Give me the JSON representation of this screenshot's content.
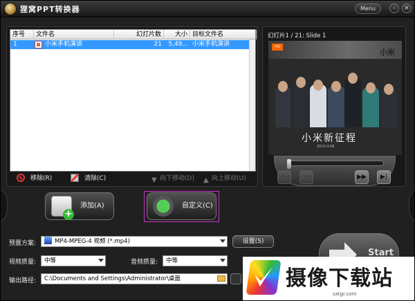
{
  "window": {
    "title": "狸窝PPT转换器",
    "menu_label": "Menu",
    "minimize_glyph": "–",
    "close_glyph": "×"
  },
  "file_list": {
    "columns": {
      "index": "序号",
      "file_name": "文件名",
      "slide_count": "幻灯片数",
      "size": "大小",
      "target_name": "目标文件名"
    },
    "rows": [
      {
        "index": "1",
        "file_name": "小米手机演讲",
        "slide_count": "21",
        "size": "5,49...",
        "target_name": "小米手机演讲",
        "selected": true
      }
    ],
    "toolbar": {
      "remove": "移除(R)",
      "clear": "清除(C)",
      "move_down": "向下移动(D)",
      "move_up": "向上移动(U)"
    }
  },
  "preview": {
    "slide_info": "幻灯片1 / 21: Slide 1",
    "slide_logo": "mi",
    "slide_brand": "小米",
    "slide_caption": "小米新征程",
    "slide_date": "2010.4.06",
    "seek_position_fraction": 0.0
  },
  "actions": {
    "add_label": "添加(A)",
    "custom_label": "自定义(C)"
  },
  "settings": {
    "preset_label": "预置方案:",
    "preset_value": "MP4-MPEG-4 视频 (*.mp4)",
    "settings_button": "设置(S)",
    "video_quality_label": "视频质量:",
    "video_quality_value": "中等",
    "audio_quality_label": "音频质量:",
    "audio_quality_value": "中等",
    "output_path_label": "输出路径:",
    "output_path_value": "C:\\Documents and Settings\\Administrator\\桌面",
    "start_label": "Start"
  },
  "watermark": {
    "text": "摄像下载站",
    "url": "sxtgr.com"
  },
  "colors": {
    "selection": "#3399ff",
    "background": "#202020",
    "highlight_frame": "#cc33cc"
  }
}
